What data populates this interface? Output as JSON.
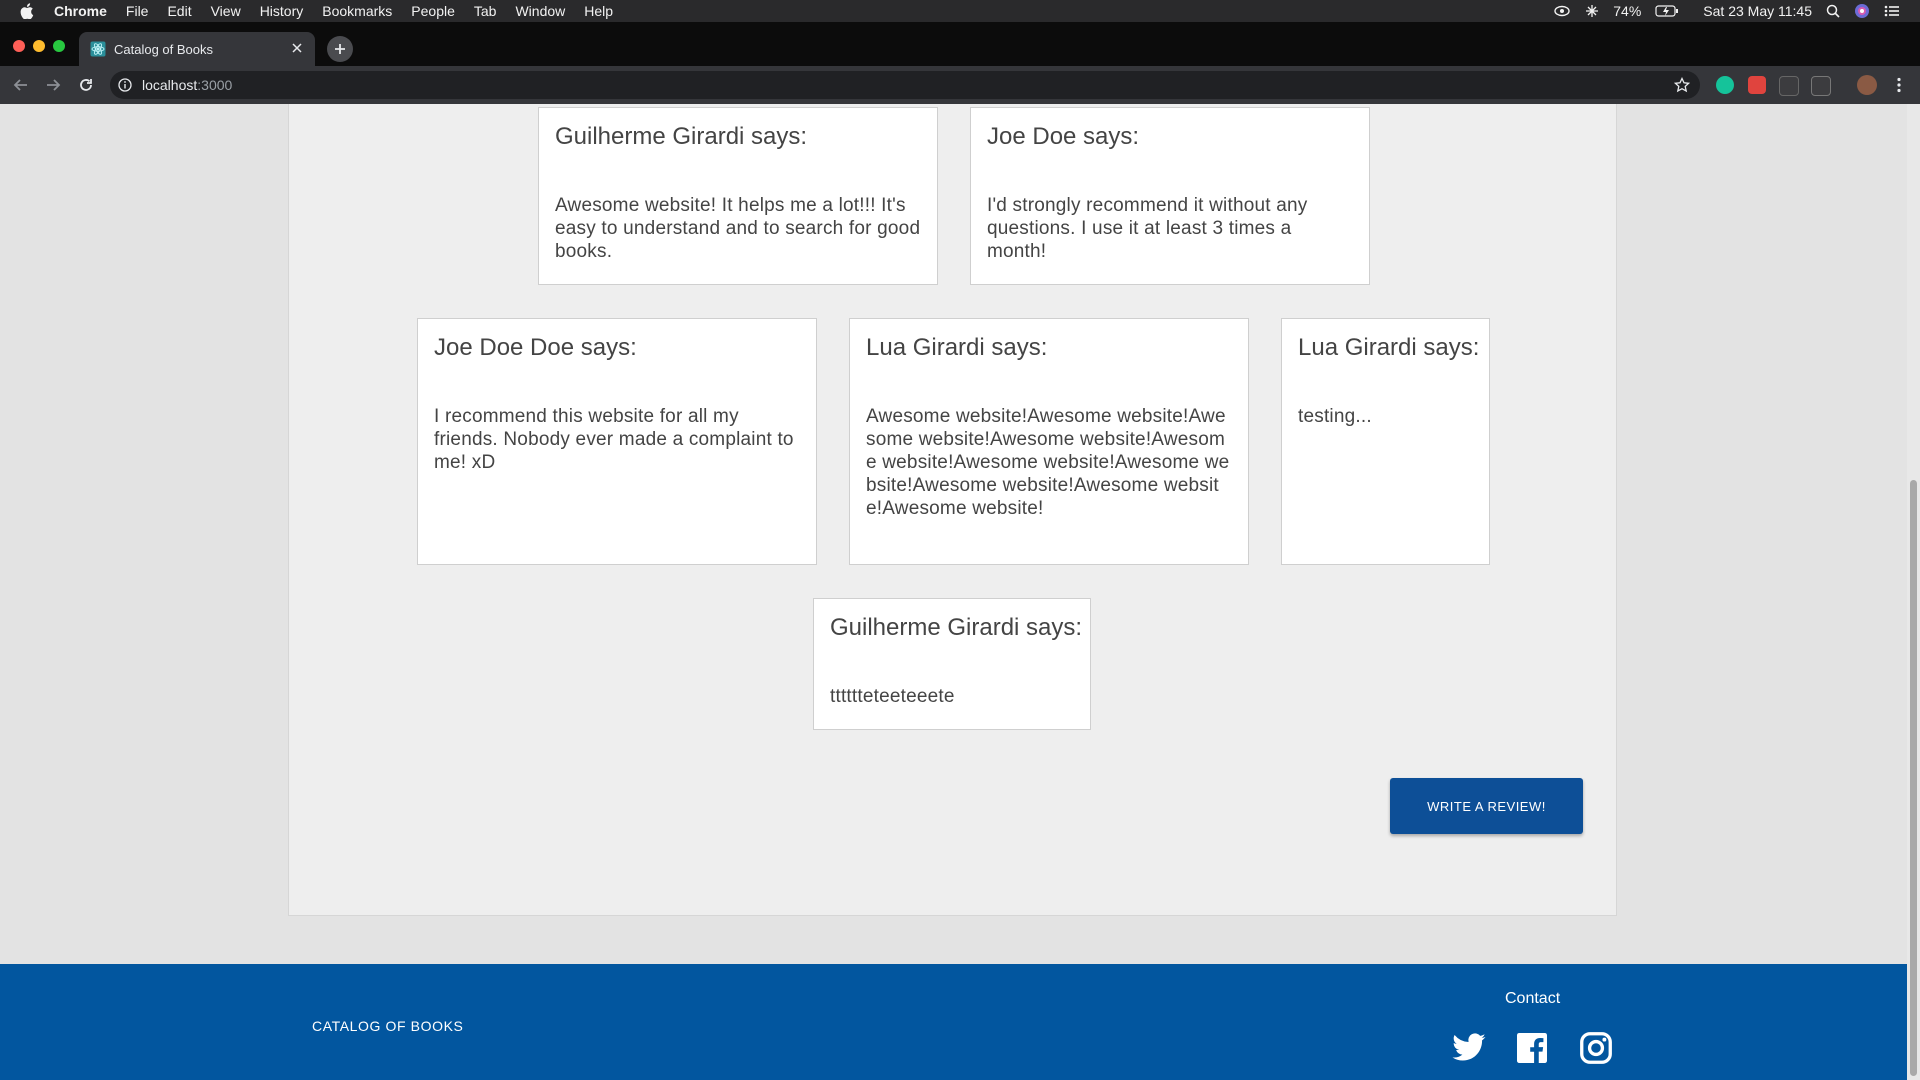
{
  "menubar": {
    "app": "Chrome",
    "items": [
      "File",
      "Edit",
      "View",
      "History",
      "Bookmarks",
      "People",
      "Tab",
      "Window",
      "Help"
    ],
    "battery": "74%",
    "datetime": "Sat 23 May  11:45"
  },
  "browser": {
    "tab_title": "Catalog of Books",
    "url_host": "localhost",
    "url_port": ":3000"
  },
  "reviews": [
    {
      "author": "Guilherme Girardi says:",
      "text": "Awesome website! It helps me a lot!!! It's easy to understand and to search for good books."
    },
    {
      "author": "Joe Doe says:",
      "text": "I'd strongly recommend it without any questions. I use it at least 3 times a month!"
    },
    {
      "author": "Joe Doe Doe says:",
      "text": "I recommend this website for all my friends. Nobody ever made a complaint to me! xD"
    },
    {
      "author": "Lua Girardi says:",
      "text": "Awesome website!Awesome website!Awesome website!Awesome website!Awesome website!Awesome website!Awesome website!Awesome website!Awesome website!Awesome website!"
    },
    {
      "author": "Lua Girardi says:",
      "text": "testing..."
    },
    {
      "author": "Guilherme Girardi says:",
      "text": "tttttteteeteeete"
    }
  ],
  "actions": {
    "write_review": "WRITE A REVIEW!"
  },
  "footer": {
    "brand": "CATALOG OF BOOKS",
    "contact": "Contact",
    "social_icons": [
      "twitter-icon",
      "facebook-icon",
      "instagram-icon"
    ]
  },
  "colors": {
    "primary": "#02569f",
    "button": "#0d4f97",
    "page_bg": "#eeeeee"
  }
}
